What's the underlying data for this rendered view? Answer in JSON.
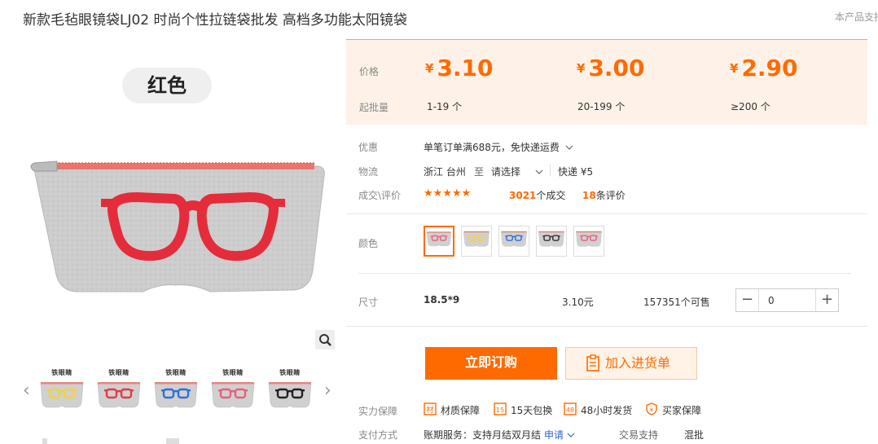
{
  "header": {
    "title": "新款毛毡眼镜袋LJ02 时尚个性拉链袋批发 高档多功能太阳镜袋",
    "notice": "本产品支持"
  },
  "gallery": {
    "color_label": "红色",
    "thumbnails": [
      {
        "brand": "铁眼睛",
        "glasses_color": "#f4d23c"
      },
      {
        "brand": "铁眼睛",
        "glasses_color": "#e43a45"
      },
      {
        "brand": "铁眼睛",
        "glasses_color": "#2f6fd6"
      },
      {
        "brand": "铁眼睛",
        "glasses_color": "#e8607a"
      },
      {
        "brand": "铁眼睛",
        "glasses_color": "#222222"
      }
    ],
    "main_glasses_color": "#e52c3a",
    "felt_color": "#cfcfcf"
  },
  "pricing": {
    "price_label": "价格",
    "moq_label": "起批量",
    "currency": "¥",
    "tiers": [
      {
        "price": "3.10",
        "quantity": "1-19 个"
      },
      {
        "price": "3.00",
        "quantity": "20-199 个"
      },
      {
        "price": "2.90",
        "quantity": "≥200 个"
      }
    ]
  },
  "details": {
    "promo_label": "优惠",
    "promo_text": "单笔订单满688元，免快递运费",
    "logistics_label": "物流",
    "origin": "浙江 台州",
    "to": "至",
    "destination": "请选择",
    "express": "快递 ¥5",
    "deal_label": "成交\\评价",
    "stars": "★★★★★",
    "deals_count": "3021",
    "deals_suffix": "个成交",
    "reviews_count": "18",
    "reviews_suffix": "条评价"
  },
  "colors": {
    "label": "颜色",
    "swatches": [
      {
        "glasses_color": "#e8607a",
        "selected": true
      },
      {
        "glasses_color": "#f4d23c",
        "selected": false
      },
      {
        "glasses_color": "#2f6fd6",
        "selected": false
      },
      {
        "glasses_color": "#333333",
        "selected": false
      },
      {
        "glasses_color": "#e8607a",
        "selected": false
      }
    ]
  },
  "size": {
    "label": "尺寸",
    "value": "18.5*9",
    "price": "3.10元",
    "stock": "157351个可售",
    "quantity": "0"
  },
  "actions": {
    "buy": "立即订购",
    "cart": "加入进货单"
  },
  "guarantees": {
    "label": "实力保障",
    "items": [
      "材质保障",
      "15天包换",
      "48小时发货",
      "买家保障"
    ]
  },
  "payment": {
    "label": "支付方式",
    "text": "账期服务：支持月结双月结",
    "apply": "申请",
    "trade_label": "交易支持",
    "trade_value": "混批"
  },
  "accent_color": "#ff6a00"
}
